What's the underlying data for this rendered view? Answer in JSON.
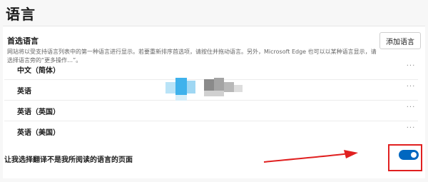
{
  "page": {
    "title": "语言"
  },
  "preferred_languages": {
    "section_title": "首选语言",
    "description": "网站将以受支持语言列表中的第一种语言进行显示。若要重新排序首选项，请按住并拖动语言。另外，Microsoft Edge 也可以以某种语言显示，请选择语言旁的“更多操作…”。",
    "add_button_label": "添加语言",
    "items": [
      {
        "label": "中文（简体）",
        "more_label": "···"
      },
      {
        "label": "英语",
        "more_label": "···"
      },
      {
        "label": "英语（英国）",
        "more_label": "···"
      },
      {
        "label": "英语（美国）",
        "more_label": "···"
      }
    ]
  },
  "translate_toggle": {
    "label": "让我选择翻译不是我所阅读的语言的页面",
    "state": "on"
  },
  "colors": {
    "accent": "#0067c0",
    "annotation_red": "#e02020"
  },
  "icons": {
    "more": "more-horizontal-icon"
  }
}
